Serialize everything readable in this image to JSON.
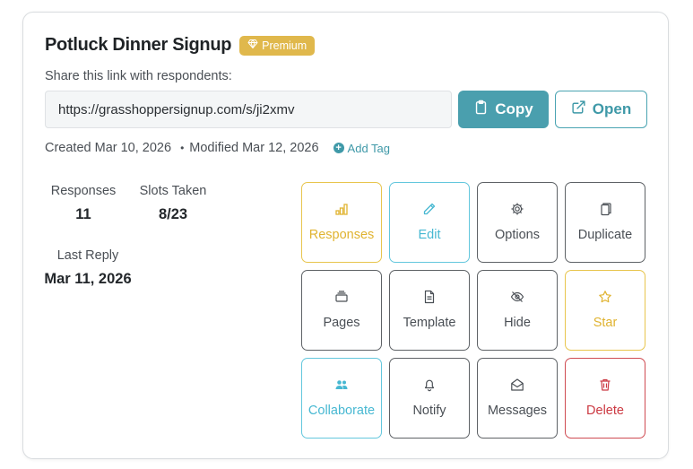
{
  "form": {
    "title": "Potluck Dinner Signup",
    "badge": "Premium",
    "share_label": "Share this link with respondents:",
    "share_url": "https://grasshoppersignup.com/s/ji2xmv",
    "copy_label": "Copy",
    "open_label": "Open",
    "created": "Created Mar 10, 2026",
    "separator": "•",
    "modified": "Modified Mar 12, 2026",
    "add_tag": "Add Tag"
  },
  "stats": {
    "responses_label": "Responses",
    "responses_value": "11",
    "slots_label": "Slots Taken",
    "slots_value": "8/23",
    "last_reply_label": "Last Reply",
    "last_reply_value": "Mar 11, 2026"
  },
  "actions": [
    {
      "label": "Responses",
      "icon": "bar-chart-icon",
      "color": "#e0b330"
    },
    {
      "label": "Edit",
      "icon": "pencil-icon",
      "color": "#47b8d2"
    },
    {
      "label": "Options",
      "icon": "gear-icon",
      "color": "#4a4f55"
    },
    {
      "label": "Duplicate",
      "icon": "copy-icon",
      "color": "#4a4f55"
    },
    {
      "label": "Pages",
      "icon": "stack-icon",
      "color": "#4a4f55"
    },
    {
      "label": "Template",
      "icon": "document-icon",
      "color": "#4a4f55"
    },
    {
      "label": "Hide",
      "icon": "eye-slash-icon",
      "color": "#4a4f55"
    },
    {
      "label": "Star",
      "icon": "star-icon",
      "color": "#e0b330"
    },
    {
      "label": "Collaborate",
      "icon": "people-icon",
      "color": "#47b8d2"
    },
    {
      "label": "Notify",
      "icon": "bell-icon",
      "color": "#4a4f55"
    },
    {
      "label": "Messages",
      "icon": "envelope-icon",
      "color": "#4a4f55"
    },
    {
      "label": "Delete",
      "icon": "trash-icon",
      "color": "#cc3a43"
    }
  ]
}
